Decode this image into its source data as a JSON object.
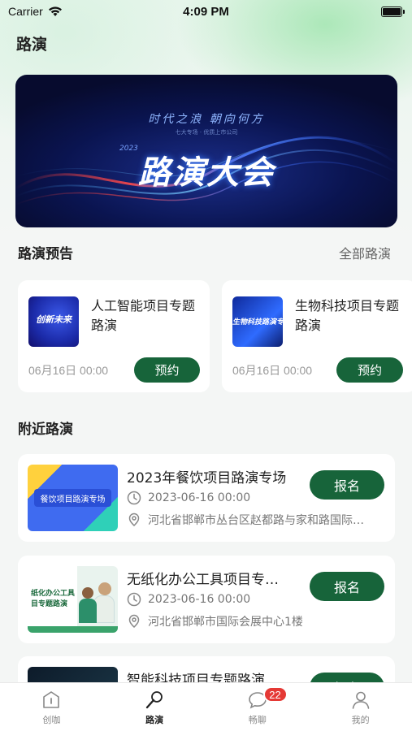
{
  "status_bar": {
    "carrier": "Carrier",
    "time": "4:09 PM"
  },
  "page_title": "路演",
  "banner": {
    "subtitle": "时代之浪  朝向何方",
    "small_text": "七大专场 · 优质上市公司",
    "year": "2023",
    "title": "路演大会"
  },
  "preview_section": {
    "title": "路演预告",
    "more_label": "全部路演",
    "cards": [
      {
        "title": "人工智能项目专题路演",
        "time": "06月16日 00:00",
        "button": "预约",
        "thumb_text": "创新未来"
      },
      {
        "title": "生物科技项目专题路演",
        "time": "06月16日 00:00",
        "button": "预约",
        "thumb_text": "生物科技路演专"
      }
    ]
  },
  "nearby_section": {
    "title": "附近路演",
    "items": [
      {
        "title": "2023年餐饮项目路演专场",
        "date": "2023-06-16 00:00",
        "address": "河北省邯郸市丛台区赵都路与家和路国际…",
        "button": "报名",
        "thumb_text": "餐饮项目路演专场"
      },
      {
        "title": "无纸化办公工具项目专…",
        "date": "2023-06-16 00:00",
        "address": "河北省邯郸市国际会展中心1楼",
        "button": "报名",
        "thumb_text": "纸化办公工具 目专题路演"
      },
      {
        "title": "智能科技项目专题路演",
        "date": "",
        "address": "",
        "button": "报名",
        "thumb_text": ""
      }
    ]
  },
  "tabbar": {
    "tabs": [
      {
        "label": "创咖",
        "icon": "info-square-icon"
      },
      {
        "label": "路演",
        "icon": "microphone-icon"
      },
      {
        "label": "畅聊",
        "icon": "chat-bubble-icon",
        "badge": "22"
      },
      {
        "label": "我的",
        "icon": "person-icon"
      }
    ],
    "active_index": 1
  },
  "colors": {
    "accent": "#17643a",
    "badge": "#e53935",
    "background": "#f4f6f5"
  }
}
